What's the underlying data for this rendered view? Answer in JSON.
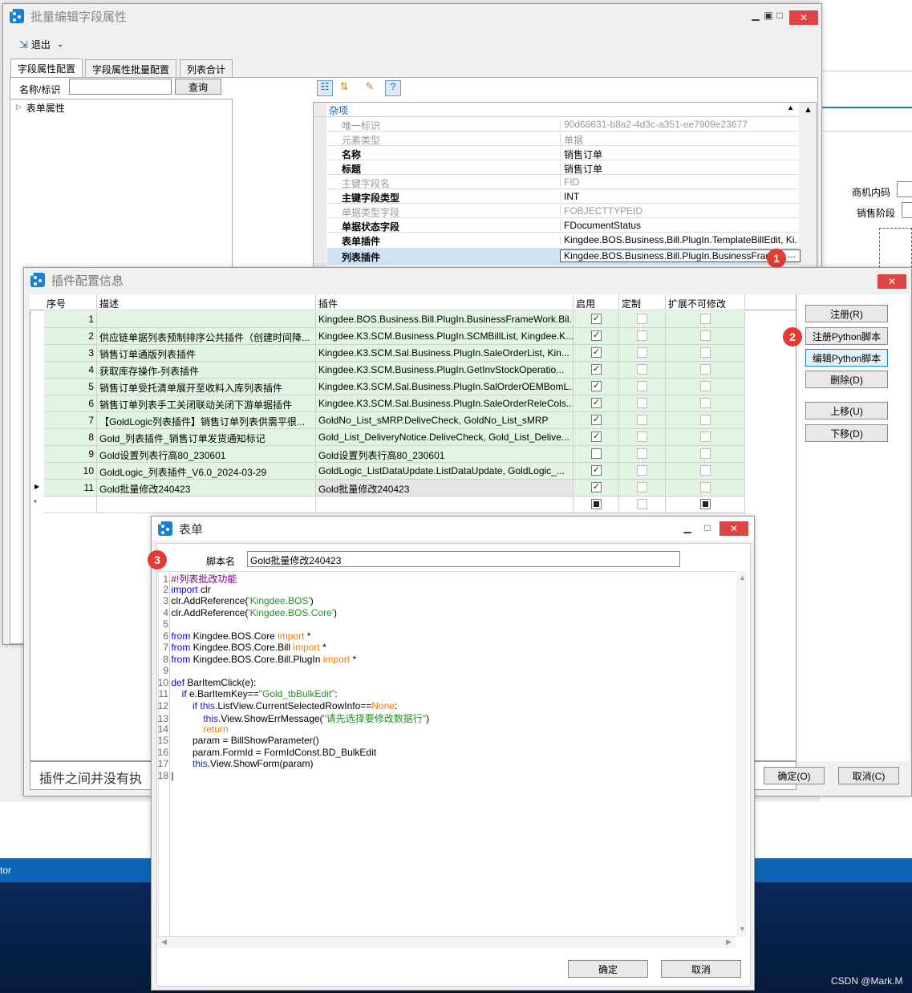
{
  "win1": {
    "title": "批量编辑字段属性",
    "exit_label": "退出",
    "tabs": [
      "字段属性配置",
      "字段属性批量配置",
      "列表合计"
    ],
    "search_label": "名称/标识",
    "search_value": "",
    "query_btn": "查询",
    "tree_root": "表单属性"
  },
  "bg": {
    "field1": "商机内码",
    "field2": "销售阶段",
    "taskbar_text": "tor",
    "watermark": "CSDN @Mark.M"
  },
  "props": {
    "category": "杂项",
    "rows": [
      {
        "k": "唯一标识",
        "v": "90d68631-b8a2-4d3c-a351-ee7909e23677"
      },
      {
        "k": "元素类型",
        "v": "单据"
      },
      {
        "k": "名称",
        "v": "销售订单"
      },
      {
        "k": "标题",
        "v": "销售订单"
      },
      {
        "k": "主键字段名",
        "v": "FID"
      },
      {
        "k": "主键字段类型",
        "v": "INT"
      },
      {
        "k": "单据类型字段",
        "v": "FOBJECTTYPEID"
      },
      {
        "k": "单据状态字段",
        "v": "FDocumentStatus"
      },
      {
        "k": "表单插件",
        "v": "Kingdee.BOS.Business.Bill.PlugIn.TemplateBillEdit, Ki..."
      },
      {
        "k": "列表插件",
        "v": "Kingdee.BOS.Business.Bill.PlugIn.BusinessFrame"
      }
    ]
  },
  "win2": {
    "title": "插件配置信息",
    "columns": [
      "序号",
      "描述",
      "插件",
      "启用",
      "定制",
      "扩展不可修改"
    ],
    "rows": [
      {
        "n": "1",
        "d": "",
        "p": "Kingdee.BOS.Business.Bill.PlugIn.BusinessFrameWork.Bil...",
        "en": true
      },
      {
        "n": "2",
        "d": "供应链单据列表预制排序公共插件（创建时间降...",
        "p": "Kingdee.K3.SCM.Business.PlugIn.SCMBillList, Kingdee.K...",
        "en": true
      },
      {
        "n": "3",
        "d": "销售订单通版列表插件",
        "p": "Kingdee.K3.SCM.Sal.Business.PlugIn.SaleOrderList, Kin...",
        "en": true
      },
      {
        "n": "4",
        "d": "获取库存操作-列表插件",
        "p": "Kingdee.K3.SCM.Business.PlugIn.GetInvStockOperatio...",
        "en": true
      },
      {
        "n": "5",
        "d": "销售订单受托清单展开至收料入库列表插件",
        "p": "Kingdee.K3.SCM.Sal.Business.PlugIn.SalOrderOEMBomL...",
        "en": true
      },
      {
        "n": "6",
        "d": "销售订单列表手工关闭联动关闭下游单据插件",
        "p": "Kingdee.K3.SCM.Sal.Business.PlugIn.SaleOrderReleCols...",
        "en": true
      },
      {
        "n": "7",
        "d": "【GoldLogic列表插件】销售订单列表供需平很...",
        "p": "GoldNo_List_sMRP.DeliveCheck, GoldNo_List_sMRP",
        "en": true
      },
      {
        "n": "8",
        "d": "Gold_列表插件_销售订单发货通知标记",
        "p": "Gold_List_DeliveryNotice.DeliveCheck, Gold_List_Delive...",
        "en": true
      },
      {
        "n": "9",
        "d": "Gold设置列表行高80_230601",
        "p": "Gold设置列表行高80_230601",
        "en": false
      },
      {
        "n": "10",
        "d": "GoldLogic_列表插件_V6.0_2024-03-29",
        "p": "GoldLogic_ListDataUpdate.ListDataUpdate, GoldLogic_...",
        "en": true
      },
      {
        "n": "11",
        "d": "Gold批量修改240423",
        "p": "Gold批量修改240423",
        "en": true
      }
    ],
    "buttons": [
      "注册(R)",
      "注册Python脚本",
      "编辑Python脚本",
      "删除(D)",
      "上移(U)",
      "下移(D)"
    ],
    "note": "插件之间并没有执",
    "ok": "确定(O)",
    "cancel": "取消(C)"
  },
  "win3": {
    "title": "表单",
    "script_label": "脚本名",
    "script_name": "Gold批量修改240423",
    "ok": "确定",
    "cancel": "取消"
  },
  "badges": [
    "1",
    "2",
    "3"
  ]
}
